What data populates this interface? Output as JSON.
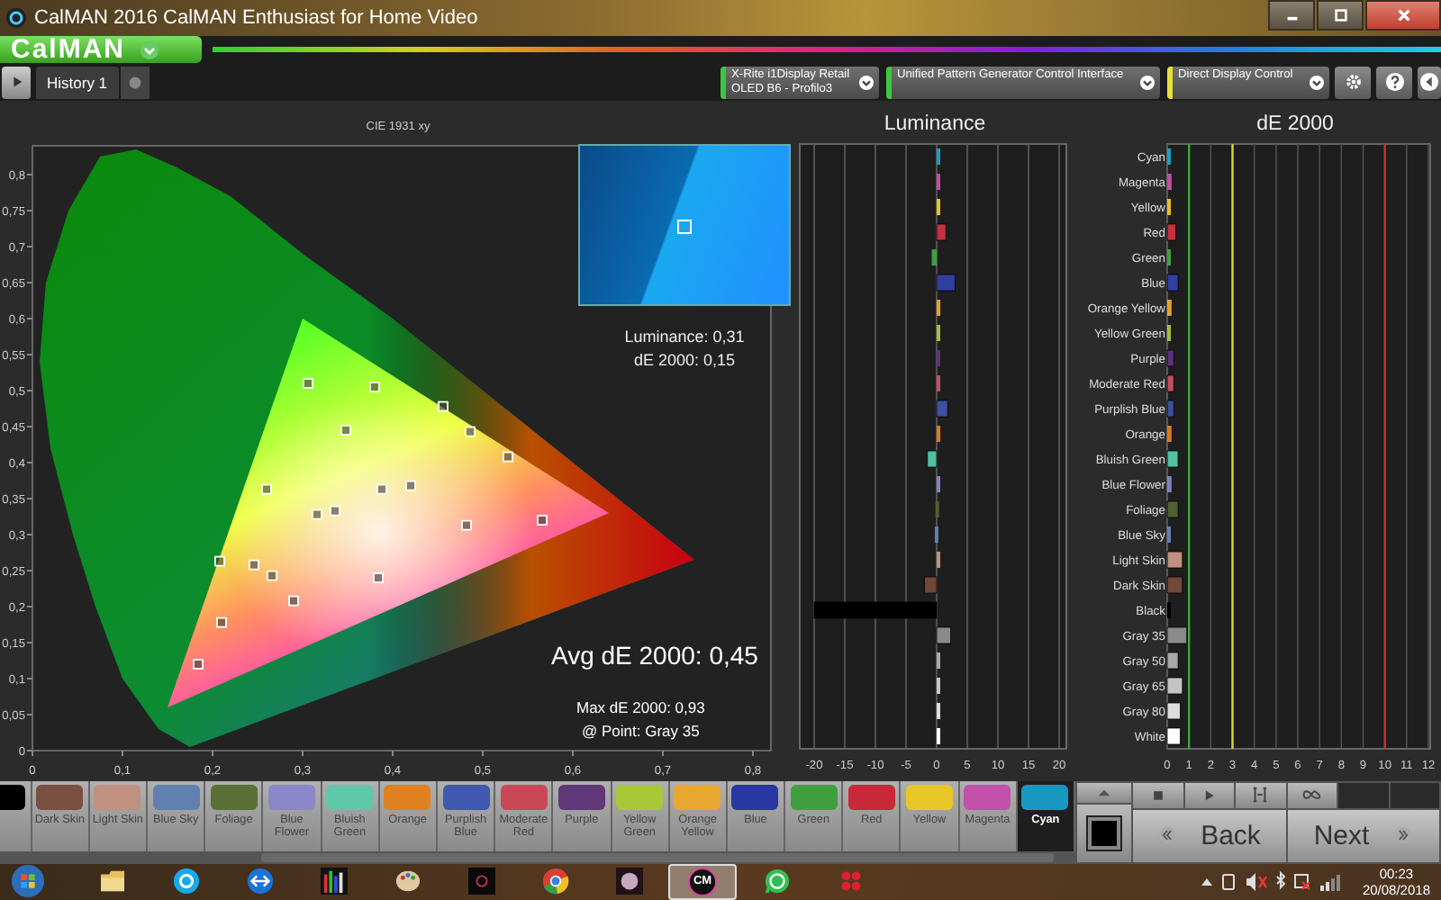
{
  "window": {
    "title": "CalMAN 2016 CalMAN Enthusiast for Home Video"
  },
  "app_menu": {
    "label": "CalMAN"
  },
  "tabs": [
    {
      "label": "History 1",
      "selected": true
    }
  ],
  "devices": [
    {
      "label": "X-Rite i1Display Retail",
      "sublabel": "OLED B6 - Profilo3",
      "color": "#3cc83c"
    },
    {
      "label": "Unified Pattern Generator Control Interface",
      "color": "#3cc83c"
    },
    {
      "label": "Direct Display Control",
      "color": "#e6e03c"
    }
  ],
  "cie": {
    "readout": [
      "Luminance: 0,31",
      "dE 2000: 0,15"
    ],
    "avg": "Avg dE 2000: 0,45",
    "max": "Max dE 2000: 0,93",
    "point": "@ Point: Gray 35",
    "chart_data": {
      "type": "scatter",
      "title": "CIE 1931 xy",
      "x": [
        0.306,
        0.38,
        0.456,
        0.486,
        0.528,
        0.348,
        0.26,
        0.388,
        0.42,
        0.316,
        0.336,
        0.482,
        0.566,
        0.208,
        0.246,
        0.266,
        0.29,
        0.384,
        0.21,
        0.184
      ],
      "series": [
        {
          "color": "#ffffff",
          "values": [
            0.51,
            0.505,
            0.478,
            0.443,
            0.408,
            0.445,
            0.363,
            0.363,
            0.368,
            0.328,
            0.333,
            0.313,
            0.32,
            0.263,
            0.258,
            0.243,
            0.208,
            0.24,
            0.178,
            0.12
          ]
        }
      ],
      "xlim": [
        0,
        0.82
      ],
      "ylim": [
        0,
        0.84
      ],
      "xticks": [
        {
          "value": 0,
          "label": "0"
        },
        {
          "value": 0.1,
          "label": "0,1"
        },
        {
          "value": 0.2,
          "label": "0,2"
        },
        {
          "value": 0.3,
          "label": "0,3"
        },
        {
          "value": 0.4,
          "label": "0,4"
        },
        {
          "value": 0.5,
          "label": "0,5"
        },
        {
          "value": 0.6,
          "label": "0,6"
        },
        {
          "value": 0.7,
          "label": "0,7"
        },
        {
          "value": 0.8,
          "label": "0,8"
        }
      ],
      "yticks": [
        {
          "value": 0,
          "label": "0"
        },
        {
          "value": 0.05,
          "label": "0,05"
        },
        {
          "value": 0.1,
          "label": "0,1"
        },
        {
          "value": 0.15,
          "label": "0,15"
        },
        {
          "value": 0.2,
          "label": "0,2"
        },
        {
          "value": 0.25,
          "label": "0,25"
        },
        {
          "value": 0.3,
          "label": "0,3"
        },
        {
          "value": 0.35,
          "label": "0,35"
        },
        {
          "value": 0.4,
          "label": "0,4"
        },
        {
          "value": 0.45,
          "label": "0,45"
        },
        {
          "value": 0.5,
          "label": "0,5"
        },
        {
          "value": 0.55,
          "label": "0,55"
        },
        {
          "value": 0.6,
          "label": "0,6"
        },
        {
          "value": 0.65,
          "label": "0,65"
        },
        {
          "value": 0.7,
          "label": "0,7"
        },
        {
          "value": 0.75,
          "label": "0,75"
        },
        {
          "value": 0.8,
          "label": "0,8"
        }
      ]
    }
  },
  "luminance": {
    "bars": [
      {
        "color": "#1a9fc0"
      },
      {
        "color": "#c050a0"
      },
      {
        "color": "#e8c020"
      },
      {
        "color": "#c83040"
      },
      {
        "color": "#40a040"
      },
      {
        "color": "#3040a0"
      },
      {
        "color": "#e8a030"
      },
      {
        "color": "#a0c040"
      },
      {
        "color": "#603080"
      },
      {
        "color": "#c05060"
      },
      {
        "color": "#4050a0"
      },
      {
        "color": "#e07820"
      },
      {
        "color": "#50c0a0"
      },
      {
        "color": "#8080c0"
      },
      {
        "color": "#506030"
      },
      {
        "color": "#6080b0"
      },
      {
        "color": "#c09080"
      },
      {
        "color": "#704838"
      },
      {
        "color": "#000000"
      },
      {
        "color": "#8a8a8a"
      },
      {
        "color": "#a8a8a8"
      },
      {
        "color": "#c4c4c4"
      },
      {
        "color": "#dcdcdc"
      },
      {
        "color": "#ffffff"
      }
    ],
    "chart_data": {
      "type": "bar",
      "orientation": "horizontal",
      "title": "Luminance",
      "grid": true,
      "series": [
        {
          "values": [
            0,
            0.3,
            0,
            1.5,
            -0.8,
            3,
            0.6,
            0.3,
            0.4,
            0.4,
            1.8,
            0.6,
            -1.5,
            0.5,
            -0.2,
            -0.3,
            0,
            -2,
            -20,
            2.3,
            0,
            0.4,
            0.4,
            0
          ]
        }
      ],
      "xlim": [
        -20,
        20
      ],
      "xticks": [
        -20,
        -15,
        -10,
        -5,
        0,
        5,
        10,
        15,
        20
      ]
    }
  },
  "de": {
    "bars": [
      {
        "color": "#1a9fc0"
      },
      {
        "color": "#c050a0"
      },
      {
        "color": "#e8c020"
      },
      {
        "color": "#c83040"
      },
      {
        "color": "#40a040"
      },
      {
        "color": "#3040a0"
      },
      {
        "color": "#e8a030"
      },
      {
        "color": "#a0c040"
      },
      {
        "color": "#603080"
      },
      {
        "color": "#c05060"
      },
      {
        "color": "#4050a0"
      },
      {
        "color": "#e07820"
      },
      {
        "color": "#50c0a0"
      },
      {
        "color": "#8080c0"
      },
      {
        "color": "#506030"
      },
      {
        "color": "#6080b0"
      },
      {
        "color": "#c09080"
      },
      {
        "color": "#704838"
      },
      {
        "color": "#000000"
      },
      {
        "color": "#8a8a8a"
      },
      {
        "color": "#a8a8a8"
      },
      {
        "color": "#c4c4c4"
      },
      {
        "color": "#dcdcdc"
      },
      {
        "color": "#ffffff"
      }
    ],
    "chart_data": {
      "type": "bar",
      "orientation": "horizontal",
      "title": "dE 2000",
      "grid": true,
      "categories": [
        "Cyan",
        "Magenta",
        "Yellow",
        "Red",
        "Green",
        "Blue",
        "Orange Yellow",
        "Yellow Green",
        "Purple",
        "Moderate Red",
        "Purplish Blue",
        "Orange",
        "Bluish Green",
        "Blue Flower",
        "Foliage",
        "Blue Sky",
        "Light Skin",
        "Dark Skin",
        "Black",
        "Gray 35",
        "Gray 50",
        "Gray 65",
        "Gray 80",
        "White"
      ],
      "series": [
        {
          "values": [
            0,
            0.2,
            0.1,
            0.4,
            0.1,
            0.5,
            0.2,
            0,
            0.3,
            0.3,
            0.3,
            0.2,
            0.5,
            0.2,
            0.5,
            0.1,
            0.7,
            0.7,
            0,
            0.9,
            0.5,
            0.7,
            0.6,
            0.6
          ]
        }
      ],
      "xlim": [
        0,
        12
      ],
      "xticks": [
        0,
        1,
        2,
        3,
        4,
        5,
        6,
        7,
        8,
        9,
        10,
        11,
        12
      ],
      "ref_lines": [
        {
          "axis": "x",
          "value": 1,
          "color": "#3aa83a"
        },
        {
          "axis": "x",
          "value": 3,
          "color": "#d8d838"
        },
        {
          "axis": "x",
          "value": 10,
          "color": "#c83030"
        }
      ]
    }
  },
  "swatches": [
    {
      "color": "#000000",
      "selected": false
    },
    {
      "label": "Dark Skin",
      "color": "#7a5040",
      "selected": false
    },
    {
      "label": "Light Skin",
      "color": "#c09080",
      "selected": false
    },
    {
      "label": "Blue Sky",
      "color": "#6080b0",
      "selected": false
    },
    {
      "label": "Foliage",
      "color": "#5a7038",
      "selected": false
    },
    {
      "label": "Blue Flower",
      "color": "#8a88c8",
      "selected": false
    },
    {
      "label": "Bluish Green",
      "color": "#60c8a8",
      "selected": false
    },
    {
      "label": "Orange",
      "color": "#e08020",
      "selected": false
    },
    {
      "label": "Purplish Blue",
      "color": "#4058b0",
      "selected": false
    },
    {
      "label": "Moderate Red",
      "color": "#c84858",
      "selected": false
    },
    {
      "label": "Purple",
      "color": "#603878",
      "selected": false
    },
    {
      "label": "Yellow Green",
      "color": "#a8c838",
      "selected": false
    },
    {
      "label": "Orange Yellow",
      "color": "#e8a830",
      "selected": false
    },
    {
      "label": "Blue",
      "color": "#2838a0",
      "selected": false
    },
    {
      "label": "Green",
      "color": "#40a040",
      "selected": false
    },
    {
      "label": "Red",
      "color": "#c82838",
      "selected": false
    },
    {
      "label": "Yellow",
      "color": "#e8c828",
      "selected": false
    },
    {
      "label": "Magenta",
      "color": "#c050a8",
      "selected": false
    },
    {
      "label": "Cyan",
      "color": "#1898c0",
      "selected": true
    }
  ],
  "nav": {
    "back": "Back",
    "next": "Next"
  },
  "taskbar": {
    "apps": [
      {
        "kind": "folder",
        "selected": false
      },
      {
        "kind": "skype",
        "selected": false
      },
      {
        "kind": "remote",
        "selected": false
      },
      {
        "kind": "bars",
        "selected": false
      },
      {
        "kind": "palette",
        "selected": false
      },
      {
        "kind": "dark",
        "selected": false
      },
      {
        "kind": "chrome",
        "selected": false
      },
      {
        "kind": "glow",
        "selected": false
      },
      {
        "kind": "cm",
        "label": "CM",
        "selected": true
      },
      {
        "kind": "whatsapp",
        "selected": false
      },
      {
        "kind": "dots",
        "selected": false
      }
    ],
    "time": "00:23",
    "date": "20/08/2018"
  }
}
